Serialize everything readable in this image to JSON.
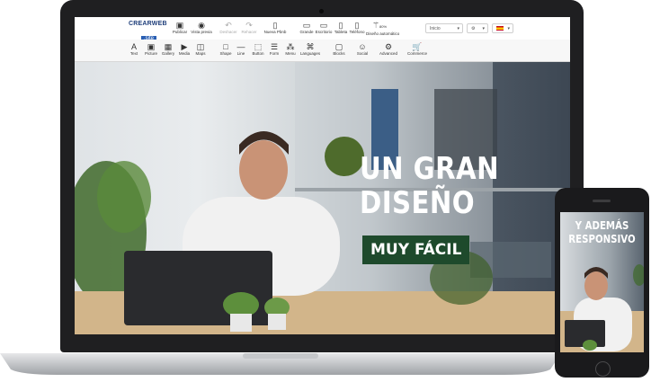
{
  "app": {
    "logo_top": "CREARWEB",
    "logo_bottom": ".site"
  },
  "toolbar_top": {
    "publish": "Publicar",
    "preview": "Vista previa",
    "undo": "Deshacer",
    "redo": "Rehacer",
    "new_page": "Nueva Pbnb",
    "view_large": "Grande",
    "view_desktop": "Escritorio",
    "view_tablet": "Tableta",
    "view_phone": "Teléfono",
    "auto_design": "Diseño automático",
    "auto_design_pct": "80%",
    "page_select": "Inicio",
    "lang_flag": "🇪🇸"
  },
  "toolbar_bottom": [
    {
      "icon": "text-icon",
      "label": "Text",
      "glyph": "A"
    },
    {
      "icon": "picture-icon",
      "label": "Picture",
      "glyph": "▣"
    },
    {
      "icon": "gallery-icon",
      "label": "Gallery",
      "glyph": "▦"
    },
    {
      "icon": "media-icon",
      "label": "Media",
      "glyph": "▶"
    },
    {
      "icon": "maps-icon",
      "label": "Maps",
      "glyph": "◫"
    },
    {
      "icon": "shape-icon",
      "label": "Shape",
      "glyph": "□"
    },
    {
      "icon": "line-icon",
      "label": "Line",
      "glyph": "—"
    },
    {
      "icon": "button-icon",
      "label": "Button",
      "glyph": "⬚"
    },
    {
      "icon": "form-icon",
      "label": "Form",
      "glyph": "☰"
    },
    {
      "icon": "menu-icon",
      "label": "Menu",
      "glyph": "⁂"
    },
    {
      "icon": "languages-icon",
      "label": "Languages",
      "glyph": "⌘"
    },
    {
      "icon": "blocks-icon",
      "label": "Blocks",
      "glyph": "▢"
    },
    {
      "icon": "social-icon",
      "label": "Social",
      "glyph": "☺"
    },
    {
      "icon": "advanced-icon",
      "label": "Advanced",
      "glyph": "⚙"
    },
    {
      "icon": "commerce-icon",
      "label": "Commerce",
      "glyph": "🛒"
    }
  ],
  "hero": {
    "line1": "UN GRAN",
    "line2": "DISEÑO",
    "badge": "MUY FÁCIL"
  },
  "phone": {
    "line1": "Y ADEMÁS",
    "line2": "RESPONSIVO"
  },
  "colors": {
    "badge_green": "#1e4a2c",
    "laptop_bezel": "#1f1f21",
    "logo_blue": "#1d3d7a"
  }
}
